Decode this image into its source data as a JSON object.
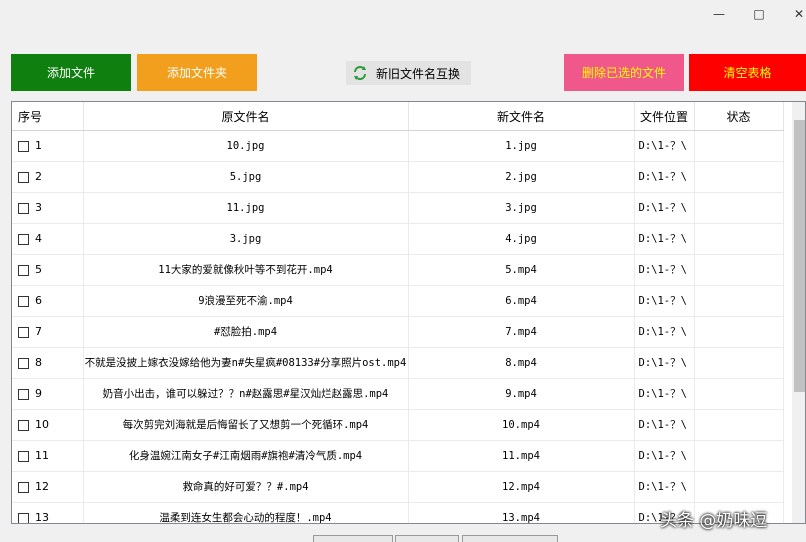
{
  "window": {
    "minimize_glyph": "—",
    "maximize_glyph": "□",
    "close_glyph": "✕"
  },
  "toolbar": {
    "add_file": "添加文件",
    "add_folder": "添加文件夹",
    "swap_names": "新旧文件名互换",
    "delete_selected": "删除已选的文件",
    "clear_table": "清空表格"
  },
  "colors": {
    "add_file_bg": "#0f7f0f",
    "add_folder_bg": "#f19f1c",
    "delete_bg": "#f0578a",
    "delete_text": "#ffff00",
    "clear_bg": "#ff0000",
    "clear_text": "#ffff00",
    "swap_icon": "#2e9a3a"
  },
  "table": {
    "headers": [
      "序号",
      "原文件名",
      "新文件名",
      "文件位置",
      "状态"
    ],
    "rows": [
      {
        "index": "1",
        "original": "10.jpg",
        "new": "1.jpg",
        "location": "D:\\1-？\\",
        "status": ""
      },
      {
        "index": "2",
        "original": "5.jpg",
        "new": "2.jpg",
        "location": "D:\\1-？\\",
        "status": ""
      },
      {
        "index": "3",
        "original": "11.jpg",
        "new": "3.jpg",
        "location": "D:\\1-？\\",
        "status": ""
      },
      {
        "index": "4",
        "original": "3.jpg",
        "new": "4.jpg",
        "location": "D:\\1-？\\",
        "status": ""
      },
      {
        "index": "5",
        "original": "11大家的爱就像秋叶等不到花开.mp4",
        "new": "5.mp4",
        "location": "D:\\1-？\\",
        "status": ""
      },
      {
        "index": "6",
        "original": "9浪漫至死不渝.mp4",
        "new": "6.mp4",
        "location": "D:\\1-？\\",
        "status": ""
      },
      {
        "index": "7",
        "original": "#怼脸拍.mp4",
        "new": "7.mp4",
        "location": "D:\\1-？\\",
        "status": ""
      },
      {
        "index": "8",
        "original": "不就是没披上嫁衣没嫁给他为妻n#失星疯#08133#分享照片ost.mp4",
        "new": "8.mp4",
        "location": "D:\\1-？\\",
        "status": ""
      },
      {
        "index": "9",
        "original": "奶音小出击，谁可以躲过？？n#赵露思#星汉灿烂赵露思.mp4",
        "new": "9.mp4",
        "location": "D:\\1-？\\",
        "status": ""
      },
      {
        "index": "10",
        "original": "每次剪完刘海就是后悔留长了又想剪一个死循环.mp4",
        "new": "10.mp4",
        "location": "D:\\1-？\\",
        "status": ""
      },
      {
        "index": "11",
        "original": "化身温婉江南女子#江南烟雨#旗袍#清冷气质.mp4",
        "new": "11.mp4",
        "location": "D:\\1-？\\",
        "status": ""
      },
      {
        "index": "12",
        "original": "救命真的好可爱？？#.mp4",
        "new": "12.mp4",
        "location": "D:\\1-？\\",
        "status": ""
      },
      {
        "index": "13",
        "original": "温柔到连女生都会心动的程度！.mp4",
        "new": "13.mp4",
        "location": "D:\\1-？\\",
        "status": ""
      }
    ]
  },
  "watermark": "头条 @奶味逗"
}
